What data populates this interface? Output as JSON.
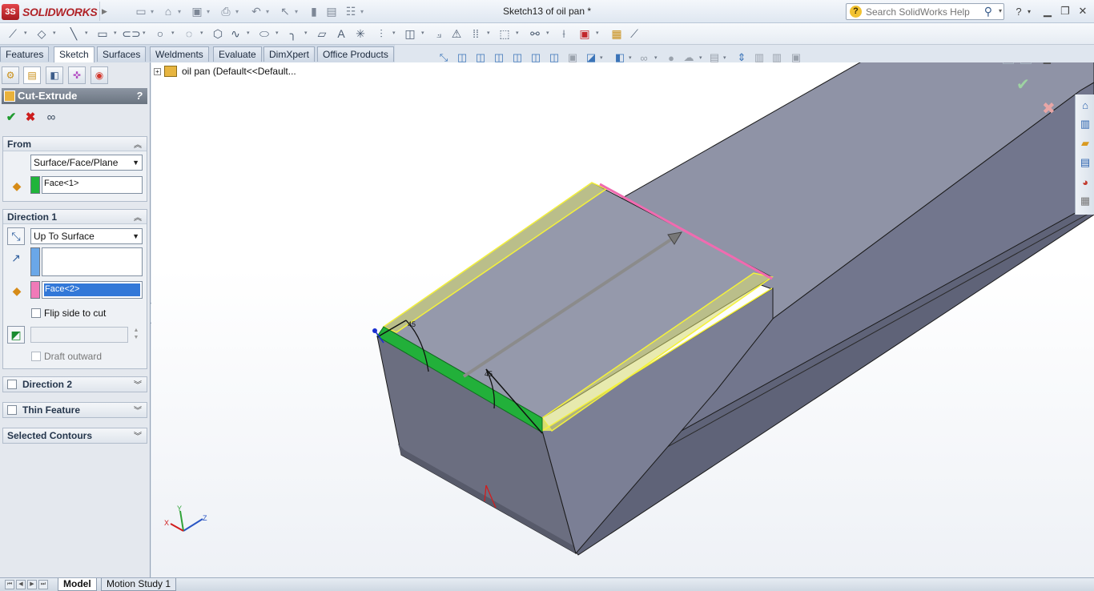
{
  "app": {
    "logo_text": "SOLIDWORKS",
    "document_title": "Sketch13 of oil pan *",
    "search_placeholder": "Search SolidWorks Help"
  },
  "command_tabs": [
    {
      "label": "Features",
      "active": false
    },
    {
      "label": "Sketch",
      "active": true
    },
    {
      "label": "Surfaces",
      "active": false
    },
    {
      "label": "Weldments",
      "active": false
    },
    {
      "label": "Evaluate",
      "active": false
    },
    {
      "label": "DimXpert",
      "active": false
    },
    {
      "label": "Office Products",
      "active": false
    }
  ],
  "feature": {
    "title": "Cut-Extrude",
    "help": "?",
    "from": {
      "heading": "From",
      "type_value": "Surface/Face/Plane",
      "entity": "Face<1>"
    },
    "direction1": {
      "heading": "Direction 1",
      "end_condition": "Up To Surface",
      "direction_entity": "",
      "face_entity": "Face<2>",
      "flip_label": "Flip side to cut",
      "draft_label": "Draft outward"
    },
    "direction2": {
      "heading": "Direction 2"
    },
    "thin_feature": {
      "heading": "Thin Feature"
    },
    "selected_contours": {
      "heading": "Selected Contours"
    }
  },
  "tree": {
    "root_label": "oil pan  (Default<<Default..."
  },
  "bottom_tabs": [
    {
      "label": "Model",
      "active": true
    },
    {
      "label": "Motion Study 1",
      "active": false
    }
  ],
  "colors": {
    "model_face": "#8f93a6",
    "model_side": "#6c7086",
    "selected_face_green": "#22b03a",
    "highlight_yellow": "#f5f23a",
    "highlight_pink": "#f06bb0",
    "accent_blue": "#3a78c2"
  },
  "triad": {
    "x": "X",
    "y": "Y",
    "z": "Z"
  }
}
